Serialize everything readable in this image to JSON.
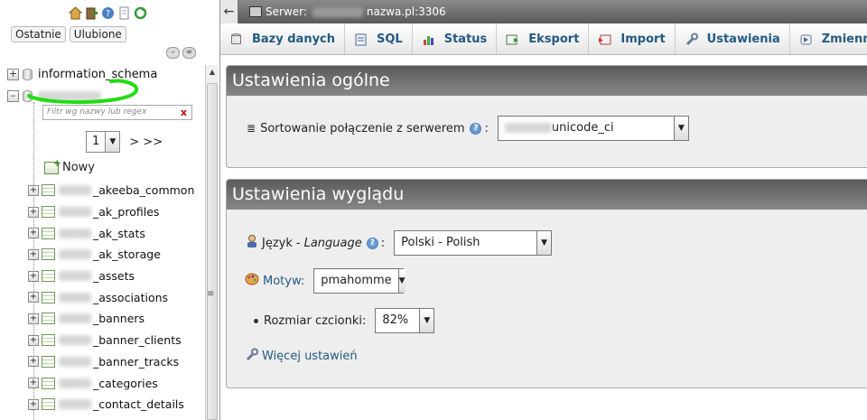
{
  "nav": {
    "icons": [
      "home-icon",
      "exit-icon",
      "help-icon",
      "docs-icon",
      "reload-icon"
    ],
    "tabs": [
      "Ostatnie",
      "Ulubione"
    ],
    "databases": [
      {
        "name": "information_schema",
        "expanded": false
      },
      {
        "name": "",
        "expanded": true
      }
    ],
    "filter_placeholder": "Filtr wg nazwy lub regex",
    "filter_clear": "x",
    "page_value": "1",
    "page_next": "> >>",
    "new_label": "Nowy",
    "tables": [
      "_akeeba_common",
      "_ak_profiles",
      "_ak_stats",
      "_ak_storage",
      "_assets",
      "_associations",
      "_banners",
      "_banner_clients",
      "_banner_tracks",
      "_categories",
      "_contact_details"
    ],
    "highlight_color": "#22dd11"
  },
  "topbar": {
    "server_label": "Serwer:",
    "server_name": "nazwa.pl:3306"
  },
  "menu": [
    {
      "label": "Bazy danych",
      "icon": "database-icon"
    },
    {
      "label": "SQL",
      "icon": "sql-icon"
    },
    {
      "label": "Status",
      "icon": "status-icon"
    },
    {
      "label": "Eksport",
      "icon": "export-icon"
    },
    {
      "label": "Import",
      "icon": "import-icon"
    },
    {
      "label": "Ustawienia",
      "icon": "wrench-icon"
    },
    {
      "label": "Zmienne",
      "icon": "variables-icon"
    }
  ],
  "general": {
    "title": "Ustawienia ogólne",
    "collation_label": "Sortowanie połączenie z serwerem",
    "collation_value": "unicode_ci"
  },
  "appearance": {
    "title": "Ustawienia wyglądu",
    "language_label": "Język",
    "language_label_en": "Language",
    "language_value": "Polski - Polish",
    "theme_label": "Motyw:",
    "theme_value": "pmahomme",
    "font_label": "Rozmiar czcionki:",
    "font_value": "82%",
    "more_link": "Więcej ustawień"
  }
}
